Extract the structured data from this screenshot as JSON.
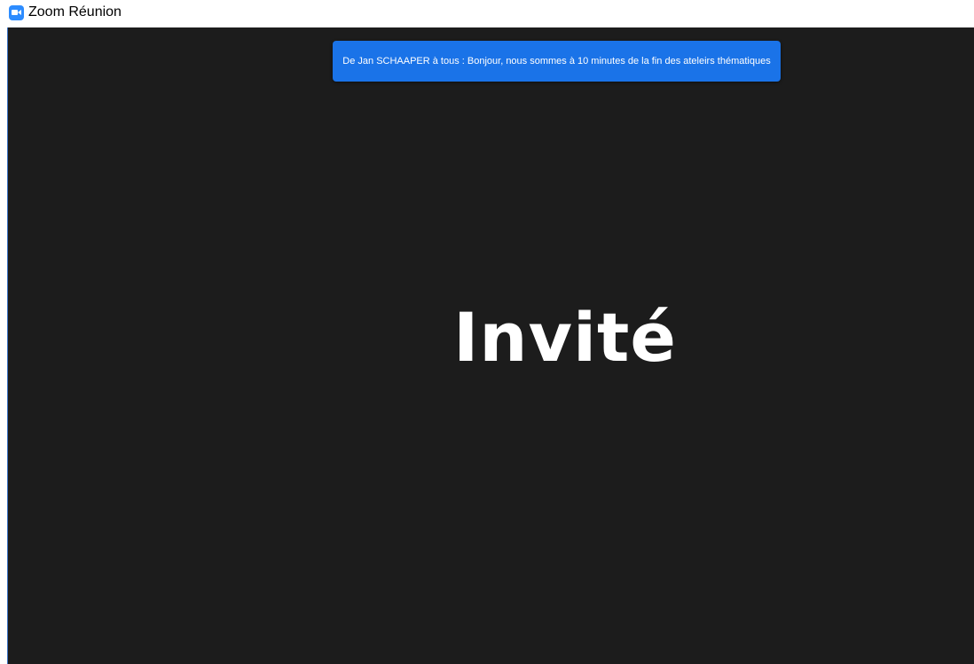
{
  "window": {
    "title": "Zoom Réunion",
    "app_icon": "zoom-camera-icon",
    "brand_color": "#2d8cff"
  },
  "chat_notification": {
    "text": "De Jan SCHAAPER à tous : Bonjour, nous sommes à 10 minutes de la fin des ateleirs thématiques",
    "background_color": "#1a73e8"
  },
  "video": {
    "participant_name": "Invité",
    "background_color": "#1c1c1c"
  }
}
